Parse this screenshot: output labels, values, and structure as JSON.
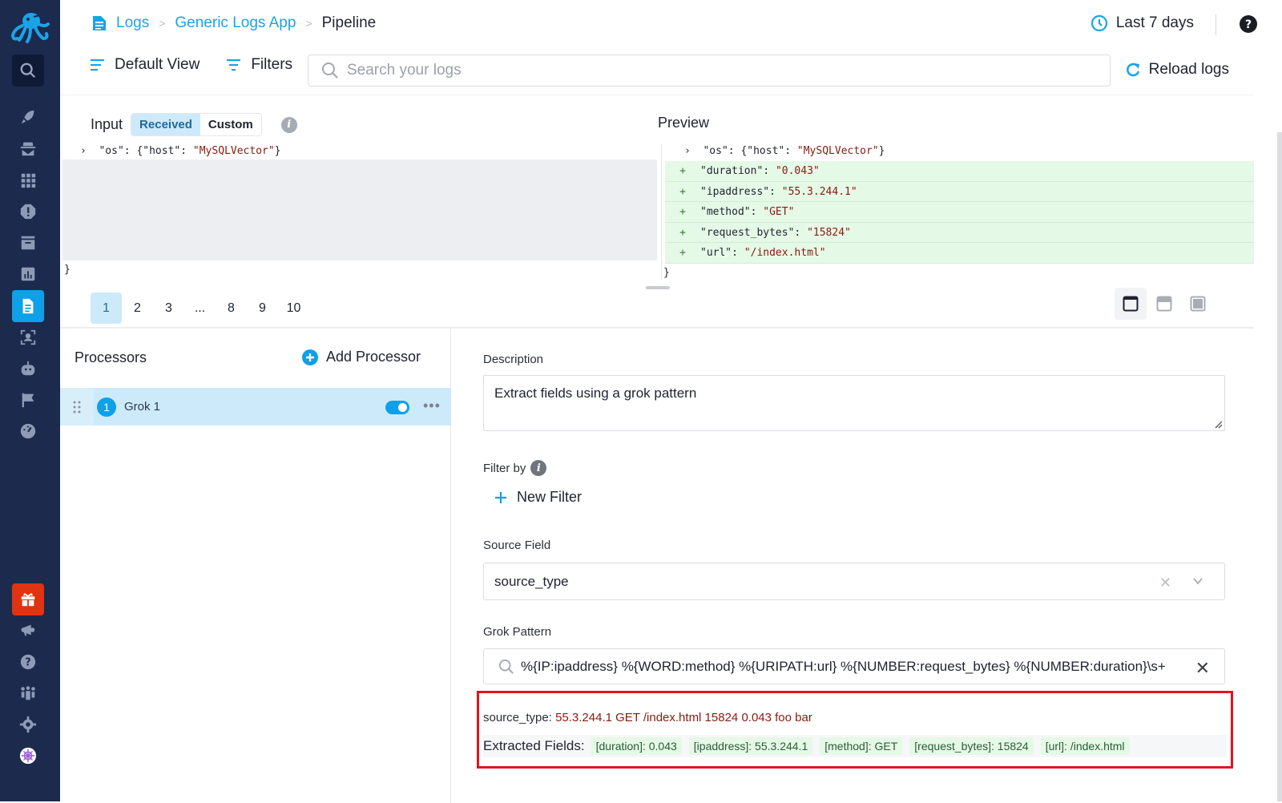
{
  "sidebar": {
    "logo": "octopus-logo",
    "items": [
      {
        "name": "search",
        "icon": "search-icon"
      },
      {
        "name": "getting-started",
        "icon": "rocket-icon"
      },
      {
        "name": "security",
        "icon": "spy-icon"
      },
      {
        "name": "apps",
        "icon": "grid-icon"
      },
      {
        "name": "alerts",
        "icon": "alert-icon"
      },
      {
        "name": "archive",
        "icon": "archive-icon"
      },
      {
        "name": "dashboards",
        "icon": "chart-icon"
      },
      {
        "name": "logs",
        "icon": "document-icon",
        "active": true
      },
      {
        "name": "user-monitoring",
        "icon": "user-scan-icon"
      },
      {
        "name": "automation",
        "icon": "robot-icon"
      },
      {
        "name": "reports",
        "icon": "flag-icon"
      },
      {
        "name": "performance",
        "icon": "gauge-icon"
      }
    ],
    "bottom_items": [
      {
        "name": "whats-new",
        "icon": "gift-icon",
        "color": "#e0330f"
      },
      {
        "name": "announcements",
        "icon": "megaphone-icon"
      },
      {
        "name": "help",
        "icon": "question-icon"
      },
      {
        "name": "team",
        "icon": "team-icon"
      },
      {
        "name": "settings",
        "icon": "gear-icon"
      },
      {
        "name": "profile",
        "icon": "avatar-icon"
      }
    ]
  },
  "header": {
    "breadcrumb": [
      "Logs",
      "Generic Logs App",
      "Pipeline"
    ],
    "time_range": "Last 7 days",
    "default_view": "Default View",
    "filters": "Filters",
    "search_placeholder": "Search your logs",
    "reload": "Reload logs"
  },
  "input": {
    "label": "Input",
    "modes": [
      "Received",
      "Custom"
    ],
    "selected_mode": "Received",
    "line": {
      "key": "\"os\"",
      "open": "{",
      "inner_key": "\"host\"",
      "inner_val": "\"MySQLVector\"",
      "close": "}"
    },
    "closing": "}"
  },
  "preview": {
    "label": "Preview",
    "line": {
      "key": "\"os\"",
      "open": "{",
      "inner_key": "\"host\"",
      "inner_val": "\"MySQLVector\"",
      "close": "}"
    },
    "added": [
      {
        "key": "\"duration\"",
        "value": "\"0.043\""
      },
      {
        "key": "\"ipaddress\"",
        "value": "\"55.3.244.1\""
      },
      {
        "key": "\"method\"",
        "value": "\"GET\""
      },
      {
        "key": "\"request_bytes\"",
        "value": "\"15824\""
      },
      {
        "key": "\"url\"",
        "value": "\"/index.html\""
      }
    ],
    "closing": "}"
  },
  "pagination": {
    "pages": [
      "1",
      "2",
      "3",
      "...",
      "8",
      "9",
      "10"
    ],
    "current": "1"
  },
  "processors": {
    "title": "Processors",
    "add_label": "Add Processor",
    "items": [
      {
        "index": "1",
        "name": "Grok 1",
        "enabled": true
      }
    ]
  },
  "form": {
    "description_label": "Description",
    "description_value": "Extract fields using a grok pattern",
    "filter_label": "Filter by",
    "new_filter": "New Filter",
    "source_field_label": "Source Field",
    "source_field_value": "source_type",
    "grok_label": "Grok Pattern",
    "grok_value": "%{IP:ipaddress} %{WORD:method} %{URIPATH:url} %{NUMBER:request_bytes} %{NUMBER:duration}\\s+"
  },
  "result": {
    "source_label": "source_type:",
    "source_value": "55.3.244.1 GET /index.html 15824 0.043 foo bar",
    "extracted_label": "Extracted Fields:",
    "fields": [
      "[duration]: 0.043",
      "[ipaddress]: 55.3.244.1",
      "[method]: GET",
      "[request_bytes]: 15824",
      "[url]: /index.html"
    ],
    "highlight_color": "#e0141e"
  }
}
